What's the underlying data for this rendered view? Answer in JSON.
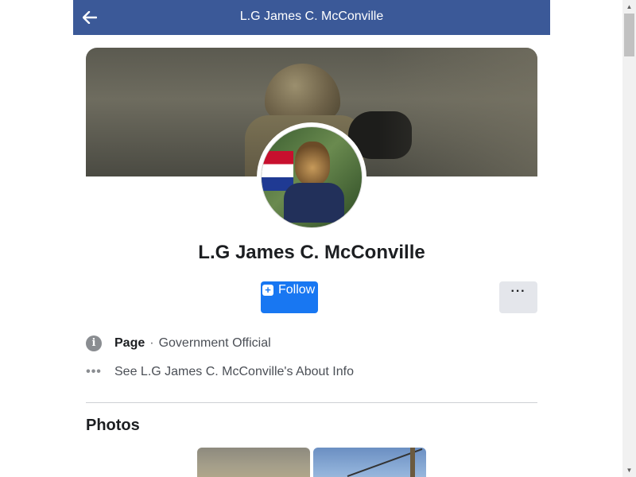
{
  "header": {
    "title": "L.G James C. McConville",
    "back_icon": "arrow-left-icon"
  },
  "profile": {
    "name": "L.G James C. McConville",
    "follow_label": "Follow",
    "follow_icon": "plus-square-icon",
    "more_label": "···"
  },
  "info": [
    {
      "icon": "info-icon",
      "strong": "Page",
      "separator": "·",
      "text": "Government Official"
    },
    {
      "icon": "more-dots-icon",
      "text": "See L.G James C. McConville's About Info"
    }
  ],
  "photos": {
    "title": "Photos"
  },
  "colors": {
    "header_bg": "#3b5998",
    "follow_button": "#1877f2",
    "secondary_button": "#e4e6eb"
  }
}
